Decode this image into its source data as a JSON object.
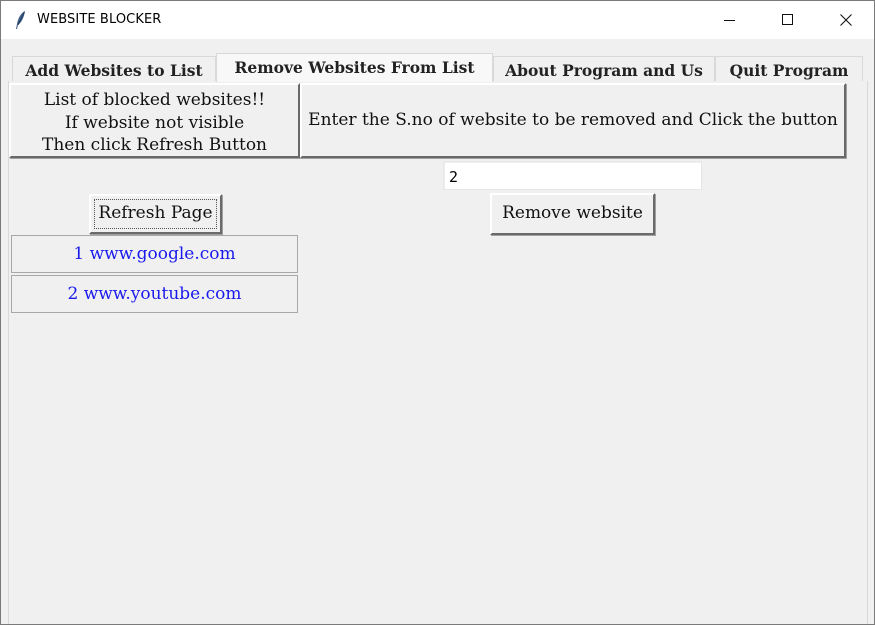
{
  "window": {
    "title": "WEBSITE BLOCKER",
    "icon": "feather-icon",
    "controls": [
      "minimize-icon",
      "maximize-icon",
      "close-icon"
    ]
  },
  "tabs": [
    {
      "label": "Add Websites to List",
      "active": false
    },
    {
      "label": "Remove Websites From List",
      "active": true
    },
    {
      "label": "About Program and Us",
      "active": false
    },
    {
      "label": "Quit Program",
      "active": false
    }
  ],
  "remove_page": {
    "info_lines": [
      "List of blocked websites!!",
      "If website not visible",
      "Then click Refresh Button"
    ],
    "instruction": "Enter the S.no of website to be removed and Click the button",
    "sno_input_value": "2",
    "remove_button_label": "Remove website",
    "refresh_button_label": "Refresh Page",
    "websites": [
      {
        "sno": "1",
        "url": "www.google.com",
        "label": "1 www.google.com"
      },
      {
        "sno": "2",
        "url": "www.youtube.com",
        "label": "2 www.youtube.com"
      }
    ]
  },
  "colors": {
    "window_bg": "#f0f0f0",
    "titlebar_bg": "#ffffff",
    "site_text": "#1a1aee",
    "input_bg": "#ffffff"
  }
}
